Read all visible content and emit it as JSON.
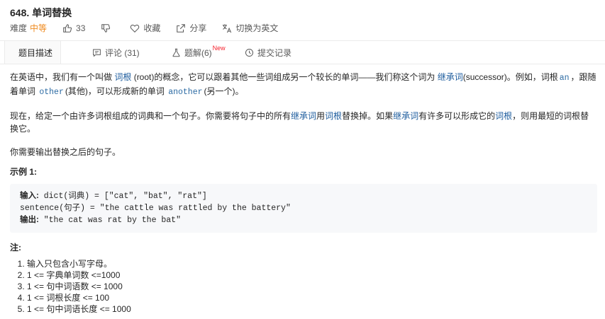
{
  "problem": {
    "title": "648. 单词替换",
    "difficulty_label": "难度",
    "difficulty": "中等",
    "likes": "33",
    "collect": "收藏",
    "share": "分享",
    "switch_lang": "切换为英文"
  },
  "tabs": [
    {
      "label": "题目描述",
      "active": true
    },
    {
      "label": "评论 (31)"
    },
    {
      "label": "题解(6)",
      "badge": "New"
    },
    {
      "label": "提交记录"
    }
  ],
  "description": {
    "p1_a": "在英语中，我们有一个叫做 ",
    "p1_root": "词根",
    "p1_b": " (root)的概念，它可以跟着其他一些词组成另一个较长的单词——我们称这个词为 ",
    "p1_successor": "继承词",
    "p1_c": "(successor)。例如，词根",
    "p1_an": "an",
    "p1_d": "，跟随着单词 ",
    "p1_other": "other",
    "p1_e": "(其他)，可以形成新的单词 ",
    "p1_another": "another",
    "p1_f": "(另一个)。",
    "p2_a": "现在，给定一个由许多词根组成的词典和一个句子。你需要将句子中的所有",
    "p2_succ1": "继承词",
    "p2_b": "用",
    "p2_root1": "词根",
    "p2_c": "替换掉。如果",
    "p2_succ2": "继承词",
    "p2_d": "有许多可以形成它的",
    "p2_root2": "词根",
    "p2_e": "，则用最短的词根替换它。",
    "p3": "你需要输出替换之后的句子。",
    "example_title": "示例 1:",
    "example": {
      "input_label": "输入:",
      "input_line1": " dict(词典) = [\"cat\", \"bat\", \"rat\"]",
      "input_line2": "sentence(句子) = \"the cattle was rattled by the battery\"",
      "output_label": "输出:",
      "output_value": " \"the cat was rat by the bat\""
    },
    "note_title": "注:",
    "notes": [
      "输入只包含小写字母。",
      "1 <= 字典单词数 <=1000",
      "1 <=  句中词语数 <= 1000",
      "1 <= 词根长度 <= 100",
      "1 <= 句中词语长度 <= 1000"
    ]
  }
}
